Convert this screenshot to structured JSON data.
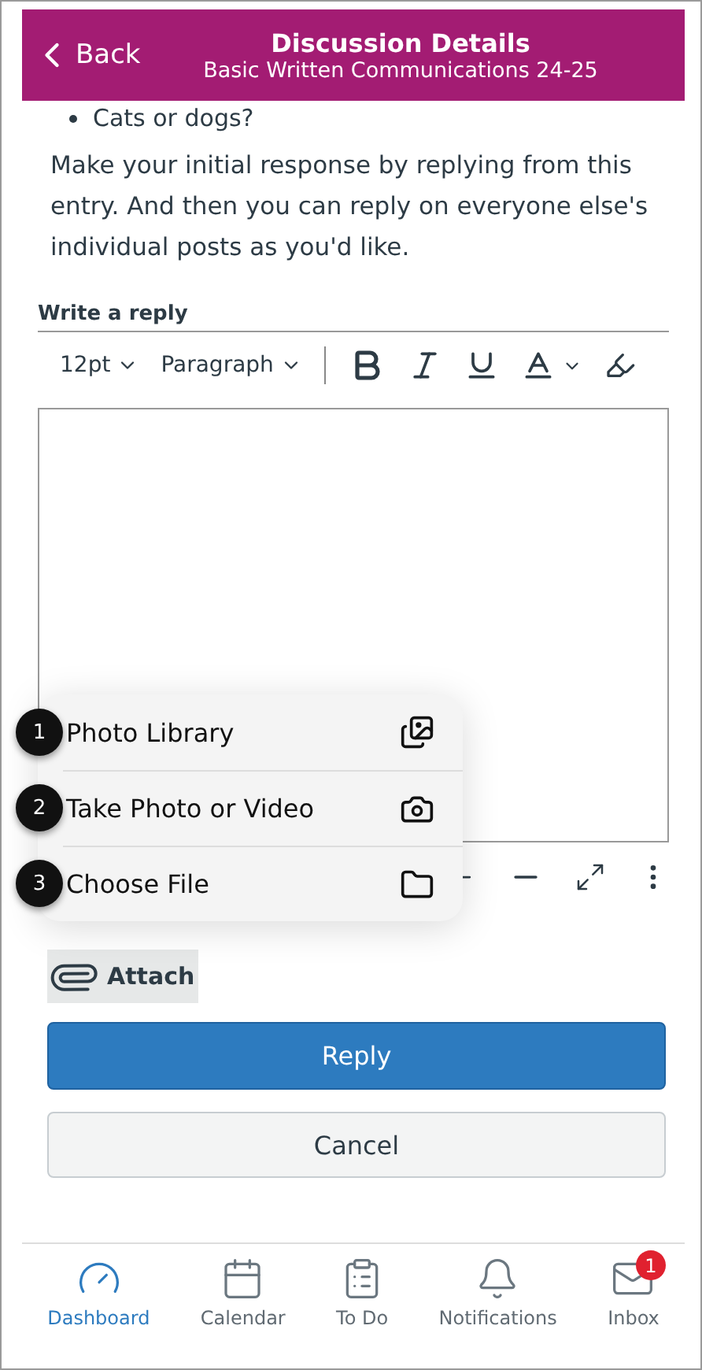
{
  "header": {
    "back": "Back",
    "title": "Discussion Details",
    "subtitle": "Basic Written Communications 24-25"
  },
  "bullets": [
    "Cats or dogs?"
  ],
  "paragraph": "Make your initial response by replying from this entry. And then you can reply on everyone else's individual posts as you'd like.",
  "reply_label": "Write a reply",
  "toolbar": {
    "font_size": "12pt",
    "block": "Paragraph"
  },
  "menu": [
    {
      "step": "1",
      "label": "Photo Library",
      "kind": "photos"
    },
    {
      "step": "2",
      "label": "Take Photo or Video",
      "kind": "camera"
    },
    {
      "step": "3",
      "label": "Choose File",
      "kind": "folder"
    }
  ],
  "attach": "Attach",
  "reply": "Reply",
  "cancel": "Cancel",
  "tabs": [
    {
      "label": "Dashboard",
      "kind": "dashboard",
      "selected": true
    },
    {
      "label": "Calendar",
      "kind": "calendar",
      "selected": false
    },
    {
      "label": "To Do",
      "kind": "todo",
      "selected": false
    },
    {
      "label": "Notifications",
      "kind": "bell",
      "selected": false
    },
    {
      "label": "Inbox",
      "kind": "mail",
      "selected": false,
      "badge": "1"
    }
  ]
}
